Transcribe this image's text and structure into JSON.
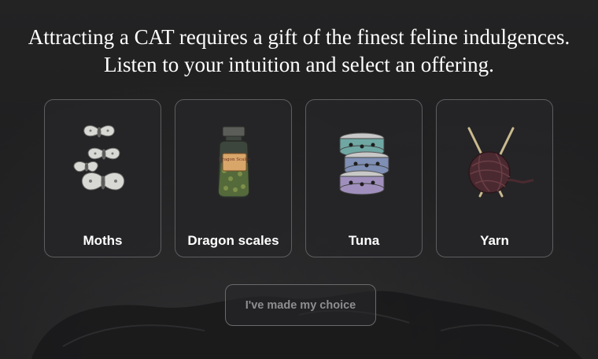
{
  "prompt": {
    "line1": "Attracting a CAT requires a gift of the finest feline indulgences.",
    "line2": "Listen to your intuition and select an offering."
  },
  "offerings": [
    {
      "label": "Moths",
      "icon": "moths-icon"
    },
    {
      "label": "Dragon scales",
      "icon": "jar-icon"
    },
    {
      "label": "Tuna",
      "icon": "tuna-cans-icon"
    },
    {
      "label": "Yarn",
      "icon": "yarn-icon"
    }
  ],
  "jar_label": "Dragon Scales",
  "submit": {
    "label": "I've made my choice",
    "state": "disabled"
  },
  "colors": {
    "background": "#1f1f20",
    "card_border": "#5e5e60",
    "text": "#ffffff",
    "button_text_disabled": "#8e8e90"
  }
}
